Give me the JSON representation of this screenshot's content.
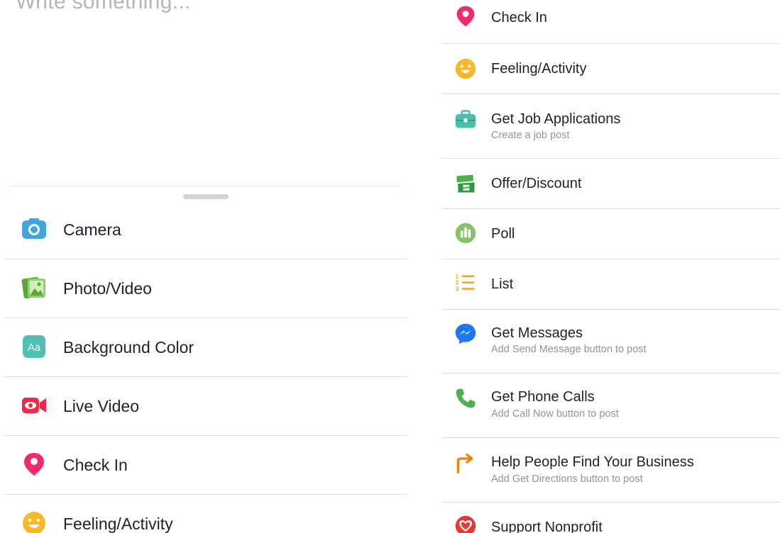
{
  "composer": {
    "placeholder": "Write something..."
  },
  "left_sheet": {
    "items": [
      {
        "label": "Camera",
        "icon": "camera-icon"
      },
      {
        "label": "Photo/Video",
        "icon": "photo-video-icon"
      },
      {
        "label": "Background Color",
        "icon": "background-color-icon"
      },
      {
        "label": "Live Video",
        "icon": "live-video-icon"
      },
      {
        "label": "Check In",
        "icon": "check-in-icon"
      },
      {
        "label": "Feeling/Activity",
        "icon": "feeling-activity-icon"
      }
    ]
  },
  "right_list": {
    "items": [
      {
        "label": "Check In",
        "icon": "check-in-icon"
      },
      {
        "label": "Feeling/Activity",
        "icon": "feeling-activity-icon"
      },
      {
        "label": "Get Job Applications",
        "sub": "Create a job post",
        "icon": "briefcase-icon"
      },
      {
        "label": "Offer/Discount",
        "icon": "offer-tag-icon"
      },
      {
        "label": "Poll",
        "icon": "poll-icon"
      },
      {
        "label": "List",
        "icon": "numbered-list-icon"
      },
      {
        "label": "Get Messages",
        "sub": "Add Send Message button to post",
        "icon": "messenger-icon"
      },
      {
        "label": "Get Phone Calls",
        "sub": "Add Call Now button to post",
        "icon": "phone-icon"
      },
      {
        "label": "Help People Find Your Business",
        "sub": "Add Get Directions button to post",
        "icon": "directions-arrow-icon"
      },
      {
        "label": "Support Nonprofit",
        "icon": "nonprofit-heart-icon"
      }
    ]
  },
  "colors": {
    "camera": "#3fa7dc",
    "photo": "#7ac356",
    "background_color": "#4fc1b4",
    "live": "#f0284a",
    "check_in": "#f02a6f",
    "feeling": "#f7b928",
    "job": "#48bfa8",
    "offer": "#45b34a",
    "poll": "#86c36a",
    "list": "#f5a623",
    "messenger": "#1877f2",
    "phone": "#4caf50",
    "directions": "#f57c00",
    "nonprofit": "#e53935"
  }
}
